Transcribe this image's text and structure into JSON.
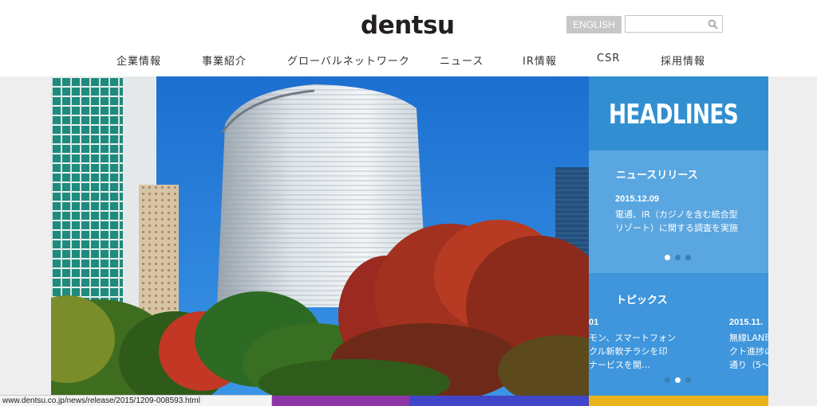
{
  "header": {
    "logo": "dentsu",
    "lang_button": "ENGLISH",
    "search_placeholder": ""
  },
  "nav": {
    "items": [
      {
        "label": "企業情報"
      },
      {
        "label": "事業紹介"
      },
      {
        "label": "グローバルネットワーク"
      },
      {
        "label": "ニュース"
      },
      {
        "label": "IR情報"
      },
      {
        "label": "CSR"
      },
      {
        "label": "採用情報"
      }
    ]
  },
  "headlines": {
    "title": "HEADLINES",
    "news": {
      "title": "ニュースリリース",
      "date": "2015.12.09",
      "lines": [
        "電通、IR（カジノを含む統合型",
        "リゾート）に関する調査を実施"
      ]
    },
    "topics": {
      "title": "トピックス",
      "item1": {
        "date": "01",
        "lines": [
          "モン、スマートフォン",
          "クル新軟チラシを印",
          "ナービスを開…"
        ]
      },
      "item2": {
        "date": "2015.11.",
        "lines": [
          "無線LAN環",
          "クト進捗の",
          "通り（5〜"
        ]
      }
    }
  },
  "status_bar": {
    "url": "www.dentsu.co.jp/news/release/2015/1209-008593.html"
  },
  "colors": {
    "headline_blue": "#318fd1",
    "news_blue": "#5aa6e0",
    "topics_blue": "#3f96dc",
    "strip_purple": "#8e36a8",
    "strip_indigo": "#4145c8",
    "strip_yellow": "#e8b21b"
  },
  "icons": [
    "search-icon"
  ]
}
